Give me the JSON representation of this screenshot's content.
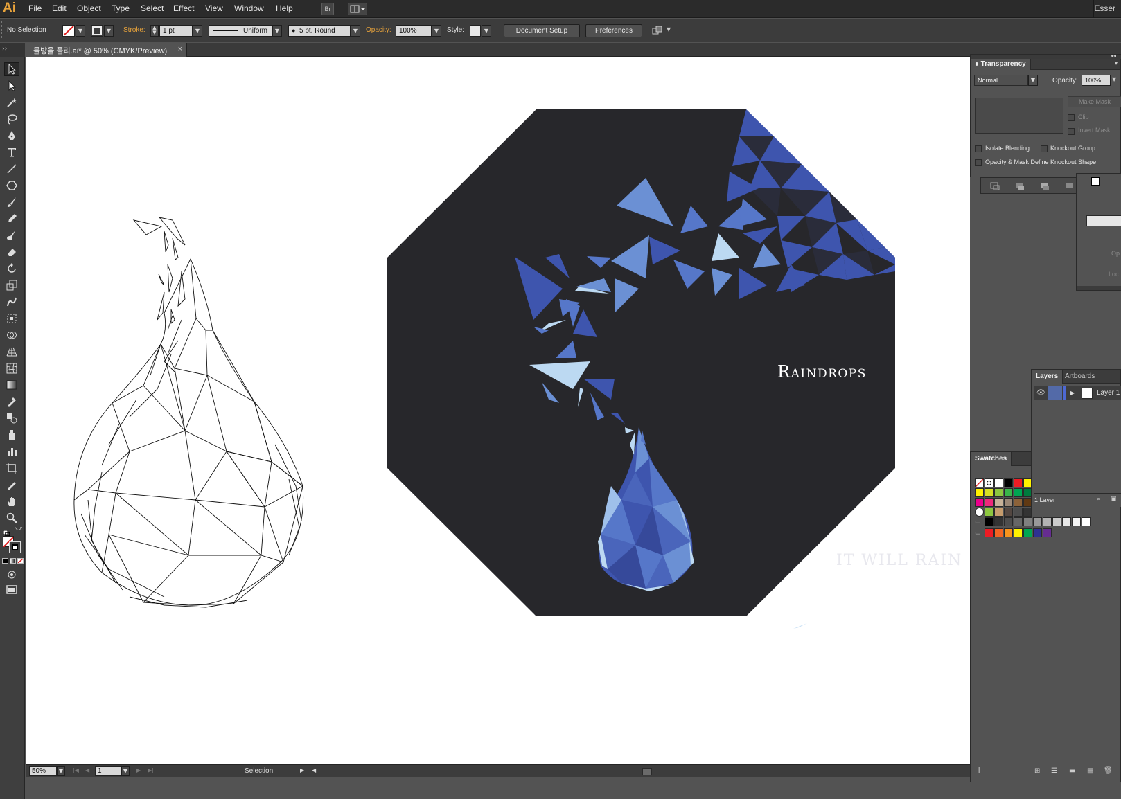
{
  "app": {
    "logo": "Ai",
    "workspace": "Esser"
  },
  "menu": [
    "File",
    "Edit",
    "Object",
    "Type",
    "Select",
    "Effect",
    "View",
    "Window",
    "Help"
  ],
  "menubar_buttons": {
    "bridge": "Br"
  },
  "control": {
    "selection_label": "No Selection",
    "stroke_label": "Stroke:",
    "stroke_weight": "1 pt",
    "profile": "Uniform",
    "brush": "5 pt. Round",
    "opacity_label": "Opacity:",
    "opacity_value": "100%",
    "style_label": "Style:",
    "document_setup": "Document Setup",
    "preferences": "Preferences"
  },
  "document": {
    "tab_title": "물방울 폴리.ai* @ 50% (CMYK/Preview)",
    "close": "×"
  },
  "artwork": {
    "title": "Raindrops",
    "tagline": "IT WILL RAIN",
    "colors": {
      "background": "#27272b",
      "blue_dark": "#3e55ae",
      "blue_mid": "#5677c9",
      "blue_light": "#6b90d4",
      "blue_pale": "#bcd9f2"
    }
  },
  "transparency_panel": {
    "title": "Transparency",
    "blend_mode": "Normal",
    "opacity_label": "Opacity:",
    "opacity_value": "100%",
    "make_mask": "Make Mask",
    "clip": "Clip",
    "invert_mask": "Invert Mask",
    "isolate_blending": "Isolate Blending",
    "knockout_group": "Knockout Group",
    "opacity_mask_knockout": "Opacity & Mask Define Knockout Shape"
  },
  "right_fragment": {
    "op": "Op",
    "loc": "Loc"
  },
  "layers_panel": {
    "tab_layers": "Layers",
    "tab_artboards": "Artboards",
    "layer_name": "Layer 1",
    "count": "1 Layer"
  },
  "swatches_panel": {
    "title": "Swatches",
    "rows": [
      [
        "#ffffff",
        "#ffffff",
        "#ffffff",
        "#000000",
        "#ed1c24",
        "#fff200"
      ],
      [
        "#fff200",
        "#d7df23",
        "#8dc63f",
        "#39b54a",
        "#00a651",
        "#007a3d"
      ],
      [
        "#ec008c",
        "#ee2a7b",
        "#c7b299",
        "#998675",
        "#8c6239",
        "#603913"
      ],
      [
        "#ffffff",
        "#8dc63f",
        "#c69c6d",
        "#534741",
        "#4d4d4d",
        "#333333"
      ],
      [
        "#000000",
        "#333333",
        "#4d4d4d",
        "#666666",
        "#808080",
        "#999999",
        "#b3b3b3",
        "#cccccc",
        "#e6e6e6",
        "#f2f2f2",
        "#ffffff"
      ],
      [
        "#ed1c24",
        "#f26522",
        "#f7941d",
        "#fff200",
        "#00a651",
        "#2e3192",
        "#662d91"
      ]
    ]
  },
  "status": {
    "zoom": "50%",
    "artboard": "1",
    "tool": "Selection"
  }
}
